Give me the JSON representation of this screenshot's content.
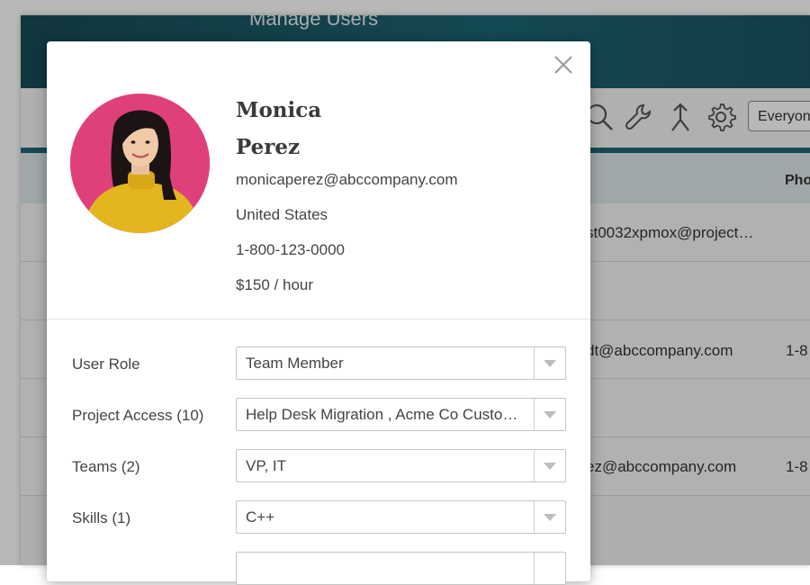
{
  "app": {
    "title": "Manage Users",
    "filter_select": "Everyon",
    "column_phone": "Pho",
    "rows": [
      {
        "email": "st0032xpmox@project…",
        "phone": ""
      },
      {
        "email": "",
        "phone": ""
      },
      {
        "email": "dt@abccompany.com",
        "phone": "1-8"
      },
      {
        "email": "",
        "phone": ""
      },
      {
        "email": "ez@abccompany.com",
        "phone": "1-8"
      }
    ],
    "icons": [
      "search-icon",
      "wrench-icon",
      "merge-icon",
      "gear-icon"
    ]
  },
  "profile": {
    "first_name": "Monica",
    "last_name": "Perez",
    "email": "monicaperez@abccompany.com",
    "country": "United States",
    "phone": "1-800-123-0000",
    "rate": "$150  /  hour"
  },
  "fields": [
    {
      "label": "User Role",
      "value": "Team Member"
    },
    {
      "label": "Project Access (10)",
      "value": "Help Desk Migration , Acme Co Customer Onboarding"
    },
    {
      "label": "Teams (2)",
      "value": "VP, IT"
    },
    {
      "label": "Skills (1)",
      "value": "C++"
    },
    {
      "label": "",
      "value": ""
    }
  ],
  "colors": {
    "header": "#1d6673",
    "avatar_bg": "#e0407a",
    "sweater": "#e3b51f"
  }
}
